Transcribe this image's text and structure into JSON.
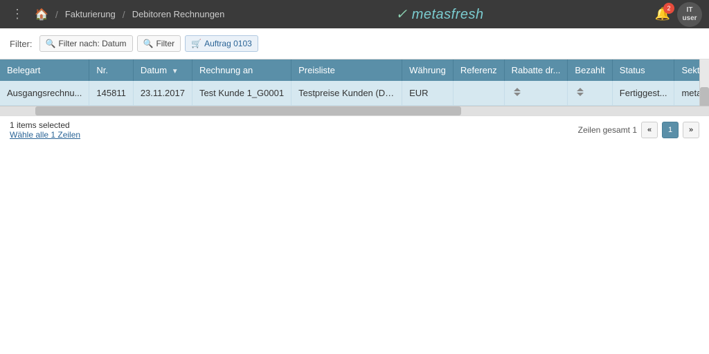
{
  "topbar": {
    "dots_label": "⋮",
    "home_icon": "🏠",
    "breadcrumb_sep1": "/",
    "breadcrumb_1": "Fakturierung",
    "breadcrumb_sep2": "/",
    "breadcrumb_2": "Debitoren Rechnungen",
    "logo": "metasfresh",
    "notif_count": "2",
    "avatar_label": "IT\nuser"
  },
  "filter_bar": {
    "filter_label": "Filter:",
    "btn_datum": "Filter nach: Datum",
    "btn_filter": "Filter",
    "btn_auftrag": "Auftrag 0103"
  },
  "table": {
    "columns": [
      {
        "id": "belegart",
        "label": "Belegart"
      },
      {
        "id": "nr",
        "label": "Nr."
      },
      {
        "id": "datum",
        "label": "Datum",
        "sortable": true
      },
      {
        "id": "rechnung_an",
        "label": "Rechnung an"
      },
      {
        "id": "preisliste",
        "label": "Preisliste"
      },
      {
        "id": "waehrung",
        "label": "Währung"
      },
      {
        "id": "referenz",
        "label": "Referenz"
      },
      {
        "id": "rabatte",
        "label": "Rabatte dr..."
      },
      {
        "id": "bezahlt",
        "label": "Bezahlt"
      },
      {
        "id": "status",
        "label": "Status"
      },
      {
        "id": "sektion",
        "label": "Sektion"
      }
    ],
    "rows": [
      {
        "belegart": "Ausgangsrechnu...",
        "nr": "145811",
        "datum": "23.11.2017",
        "rechnung_an": "Test Kunde 1_G0001",
        "preisliste": "Testpreise Kunden (Deutschla...",
        "waehrung": "EUR",
        "referenz": "",
        "rabatte": "↕",
        "bezahlt": "↕",
        "status": "Fertiggest...",
        "sektion": "metas"
      }
    ]
  },
  "footer": {
    "selected_text": "1 items selected",
    "select_all_link": "Wähle alle 1 Zeilen",
    "rows_total_label": "Zeilen gesamt 1",
    "page_prev": "«",
    "page_current": "1",
    "page_next": "»"
  }
}
